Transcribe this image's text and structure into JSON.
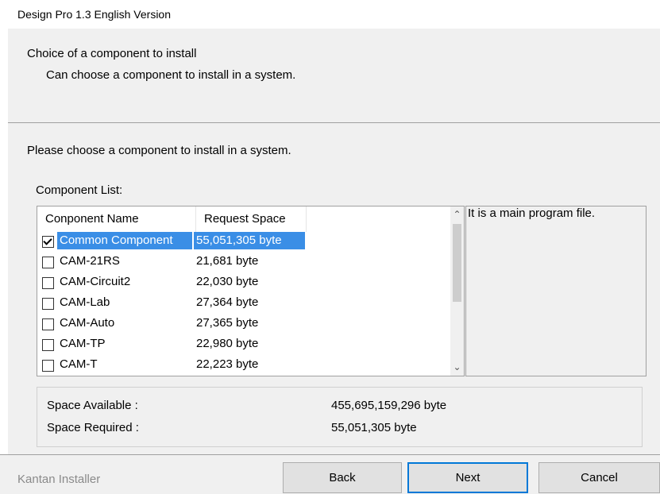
{
  "window": {
    "title": "Design Pro 1.3 English Version"
  },
  "header": {
    "heading": "Choice of a component to install",
    "subheading": "Can choose a component to install in a system."
  },
  "body": {
    "instruction": "Please choose a component to install in a system.",
    "component_list_label": "Component List:"
  },
  "component_list": {
    "columns": [
      "Conponent Name",
      "Request Space"
    ],
    "rows": [
      {
        "name": "Common Component",
        "size": "55,051,305 byte",
        "checked": true,
        "selected": true
      },
      {
        "name": "CAM-21RS",
        "size": "21,681 byte",
        "checked": false,
        "selected": false
      },
      {
        "name": "CAM-Circuit2",
        "size": "22,030 byte",
        "checked": false,
        "selected": false
      },
      {
        "name": "CAM-Lab",
        "size": "27,364 byte",
        "checked": false,
        "selected": false
      },
      {
        "name": "CAM-Auto",
        "size": "27,365 byte",
        "checked": false,
        "selected": false
      },
      {
        "name": "CAM-TP",
        "size": "22,980 byte",
        "checked": false,
        "selected": false
      },
      {
        "name": "CAM-T",
        "size": "22,223 byte",
        "checked": false,
        "selected": false
      }
    ],
    "scrollbar": {
      "up_icon": "chevron-up-icon",
      "down_icon": "chevron-down-icon"
    }
  },
  "description": {
    "text": "It is a main program file."
  },
  "space": {
    "available_label": "Space Available :",
    "available_value": "455,695,159,296 byte",
    "required_label": "Space Required :",
    "required_value": "55,051,305 byte"
  },
  "footer": {
    "brand": "Kantan Installer",
    "back_label": "Back",
    "next_label": "Next",
    "cancel_label": "Cancel"
  },
  "colors": {
    "selection": "#3a8ee6",
    "accent": "#0078d7",
    "panel": "#f0f0f0"
  }
}
